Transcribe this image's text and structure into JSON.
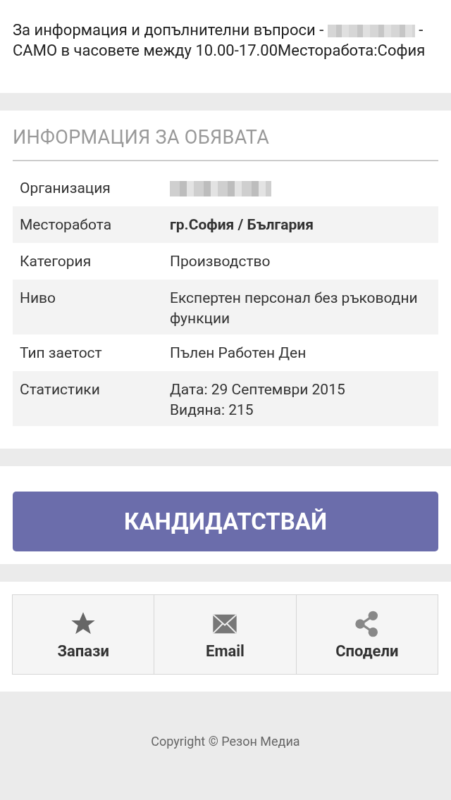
{
  "contact": {
    "line_start": "За информация и допълнителни въпроси -",
    "line_end": "- САМО в часовете между 10.00-17.00Месторабота:София"
  },
  "info": {
    "title": "ИНФОРМАЦИЯ ЗА ОБЯВАТА",
    "rows": [
      {
        "label": "Организация",
        "kind": "blurred",
        "values": []
      },
      {
        "label": "Месторабота",
        "kind": "strong",
        "values": [
          "гр.София / България"
        ]
      },
      {
        "label": "Категория",
        "kind": "text",
        "values": [
          "Производство"
        ]
      },
      {
        "label": "Ниво",
        "kind": "text",
        "values": [
          "Експертен персонал без ръководни функции"
        ]
      },
      {
        "label": "Тип заетост",
        "kind": "text",
        "values": [
          "Пълен Работен Ден"
        ]
      },
      {
        "label": "Статистики",
        "kind": "text",
        "values": [
          "Дата: 29 Септември 2015",
          "Видяна: 215"
        ]
      }
    ]
  },
  "apply_button": "КАНДИДАТСТВАЙ",
  "actions": [
    {
      "label": "Запази",
      "kind": "star"
    },
    {
      "label": "Email",
      "kind": "mail"
    },
    {
      "label": "Сподели",
      "kind": "share"
    }
  ],
  "footer": "Copyright © Резон Медиа"
}
